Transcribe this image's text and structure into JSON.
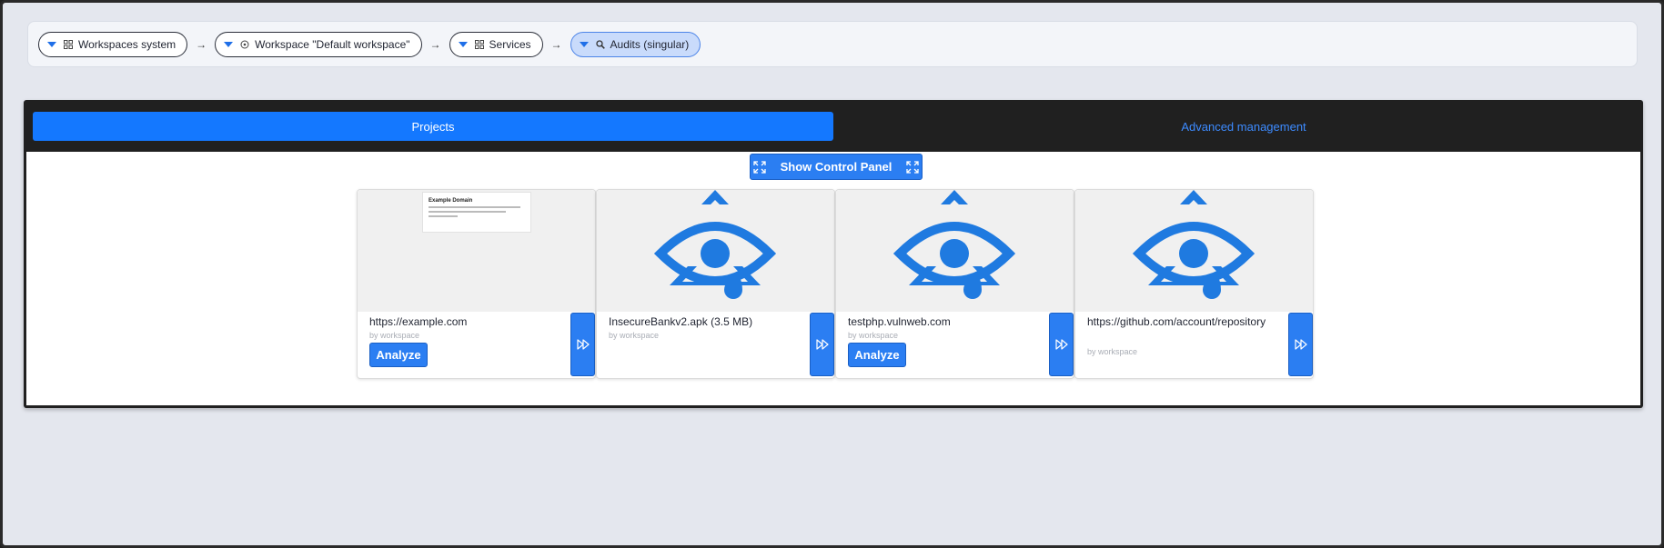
{
  "breadcrumb": [
    {
      "label": "Workspaces system",
      "icon": "grid-icon",
      "active": false
    },
    {
      "label": "Workspace \"Default workspace\"",
      "icon": "target-icon",
      "active": false
    },
    {
      "label": "Services",
      "icon": "grid-icon",
      "active": false
    },
    {
      "label": "Audits (singular)",
      "icon": "search-icon",
      "active": true
    }
  ],
  "breadcrumb_separator": "→",
  "tabs": {
    "projects": "Projects",
    "advanced": "Advanced management"
  },
  "show_control_panel": "Show Control Panel",
  "mini_page_title": "Example Domain",
  "cards": [
    {
      "title": "https://example.com",
      "by": "by workspace",
      "analyze": "Analyze",
      "thumbnail": "page-preview"
    },
    {
      "title": "InsecureBankv2.apk (3.5 MB)",
      "by": "by workspace",
      "analyze": null,
      "thumbnail": "eye-logo"
    },
    {
      "title": "testphp.vulnweb.com",
      "by": "by workspace",
      "analyze": "Analyze",
      "thumbnail": "eye-logo"
    },
    {
      "title": "https://github.com/account/repository",
      "by": "by workspace",
      "analyze": null,
      "thumbnail": "eye-logo"
    }
  ],
  "colors": {
    "accent": "#1478ff",
    "button": "#2b7ef2",
    "logo": "#1f7ae0"
  }
}
